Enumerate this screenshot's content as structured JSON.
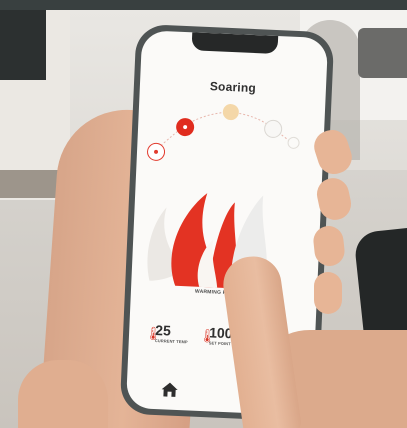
{
  "app": {
    "title": "Soaring",
    "footprint_label": "WARMING FLE",
    "stats": [
      {
        "value": "25",
        "label": "CURRENT TEMP"
      },
      {
        "value": "100",
        "label": "SET POINT"
      }
    ],
    "home_icon": "home-icon"
  },
  "colors": {
    "accent_red": "#e02c1e",
    "warm_glow": "#f4d7a8",
    "screen_bg": "#fbfaf8"
  }
}
